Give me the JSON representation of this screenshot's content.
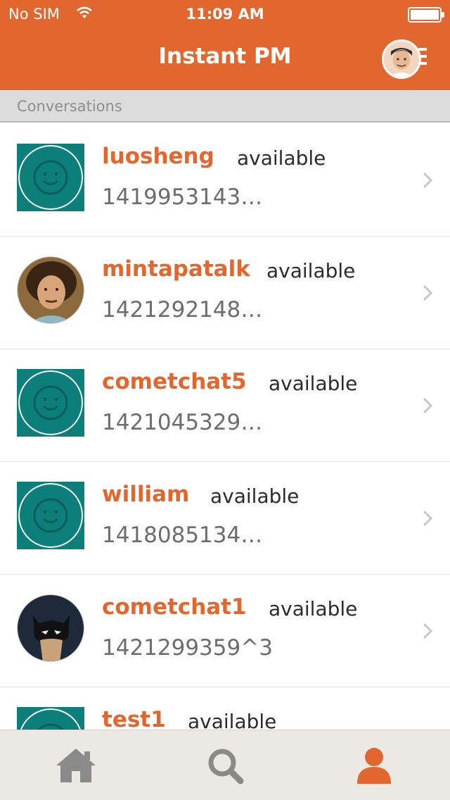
{
  "status_bar": {
    "carrier": "No SIM",
    "time": "11:09 AM",
    "battery": 1.0
  },
  "header": {
    "title": "Instant PM"
  },
  "section": {
    "label": "Conversations"
  },
  "conversations": [
    {
      "name": "luosheng",
      "status": "available",
      "preview": "1419953143…",
      "avatar": "smiley-placeholder"
    },
    {
      "name": "mintapatalk",
      "status": "available",
      "preview": "1421292148…",
      "avatar": "photo-curly-hair"
    },
    {
      "name": "cometchat5",
      "status": "available",
      "preview": "1421045329…",
      "avatar": "smiley-placeholder"
    },
    {
      "name": "william",
      "status": "available",
      "preview": "1418085134…",
      "avatar": "smiley-placeholder"
    },
    {
      "name": "cometchat1",
      "status": "available",
      "preview": "1421299359^3",
      "avatar": "photo-batman"
    },
    {
      "name": "test1",
      "status": "available",
      "preview": "",
      "avatar": "smiley-placeholder"
    }
  ],
  "tabbar": {
    "items": [
      {
        "icon": "home-icon",
        "active": false
      },
      {
        "icon": "search-icon",
        "active": false
      },
      {
        "icon": "user-icon",
        "active": true
      }
    ]
  },
  "colors": {
    "accent": "#e2672f",
    "placeholder_avatar": "#0c7f7b",
    "tab_inactive": "#8a8a8a"
  }
}
